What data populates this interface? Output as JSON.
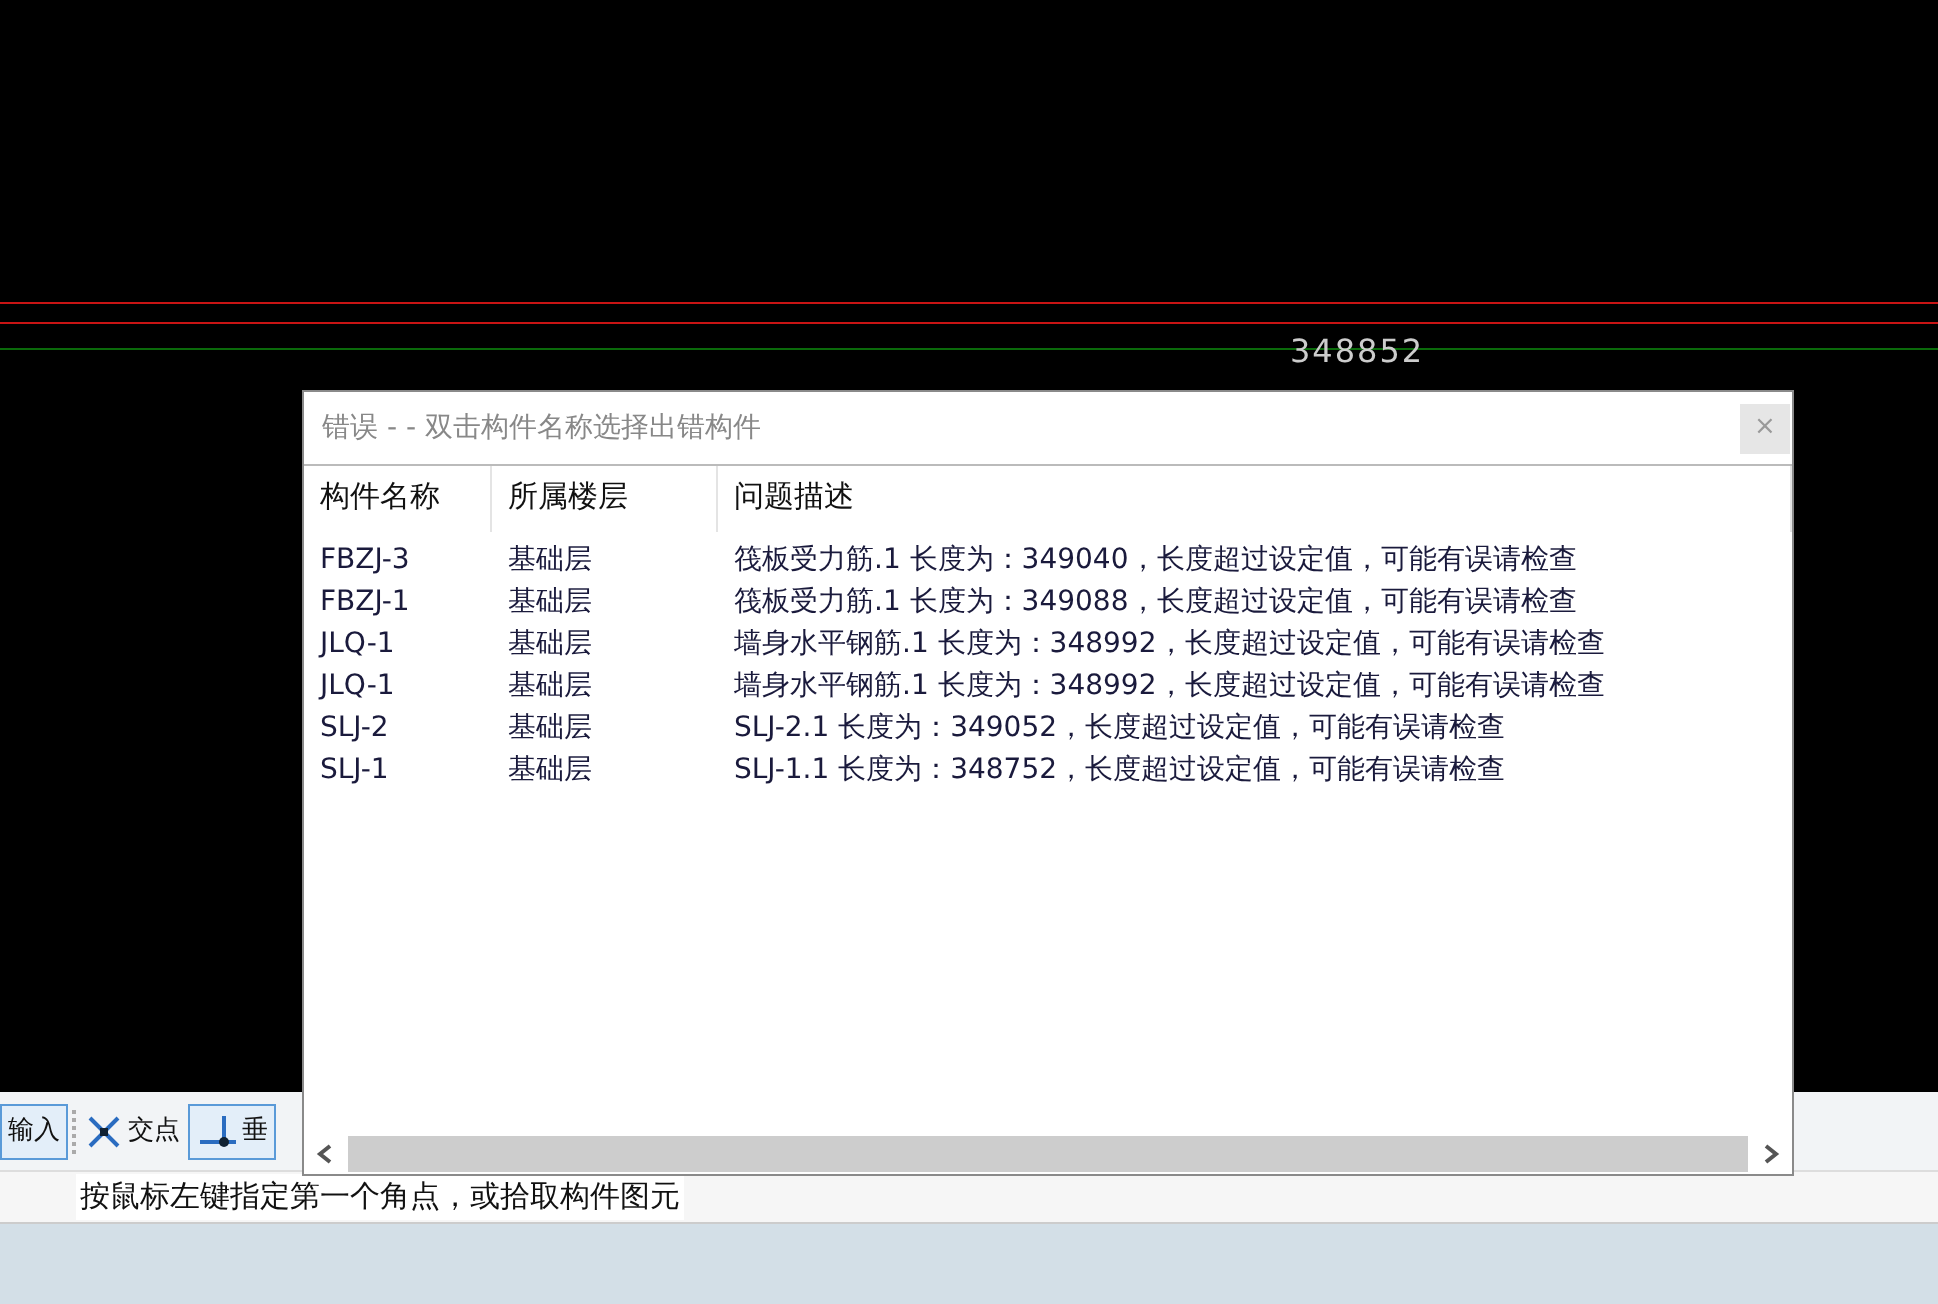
{
  "canvas": {
    "dimension": "348852"
  },
  "toolbar": {
    "items": [
      {
        "label": "输入",
        "kind": "input"
      },
      {
        "label": "交点",
        "kind": "intersection"
      },
      {
        "label": "垂",
        "kind": "perpendicular"
      }
    ]
  },
  "status_bar": {
    "prompt": "按鼠标左键指定第一个角点，或拾取构件图元"
  },
  "dialog": {
    "title": "错误 - - 双击构件名称选择出错构件",
    "close": "×",
    "columns": [
      "构件名称",
      "所属楼层",
      "问题描述"
    ],
    "rows": [
      {
        "name": "FBZJ-3",
        "floor": "基础层",
        "description": "筏板受力筋.1 长度为：349040，长度超过设定值，可能有误请检查"
      },
      {
        "name": "FBZJ-1",
        "floor": "基础层",
        "description": "筏板受力筋.1 长度为：349088，长度超过设定值，可能有误请检查"
      },
      {
        "name": "JLQ-1",
        "floor": "基础层",
        "description": "墙身水平钢筋.1 长度为：348992，长度超过设定值，可能有误请检查"
      },
      {
        "name": "JLQ-1",
        "floor": "基础层",
        "description": "墙身水平钢筋.1 长度为：348992，长度超过设定值，可能有误请检查"
      },
      {
        "name": "SLJ-2",
        "floor": "基础层",
        "description": "SLJ-2.1 长度为：349052，长度超过设定值，可能有误请检查"
      },
      {
        "name": "SLJ-1",
        "floor": "基础层",
        "description": "SLJ-1.1 长度为：348752，长度超过设定值，可能有误请检查"
      }
    ]
  }
}
